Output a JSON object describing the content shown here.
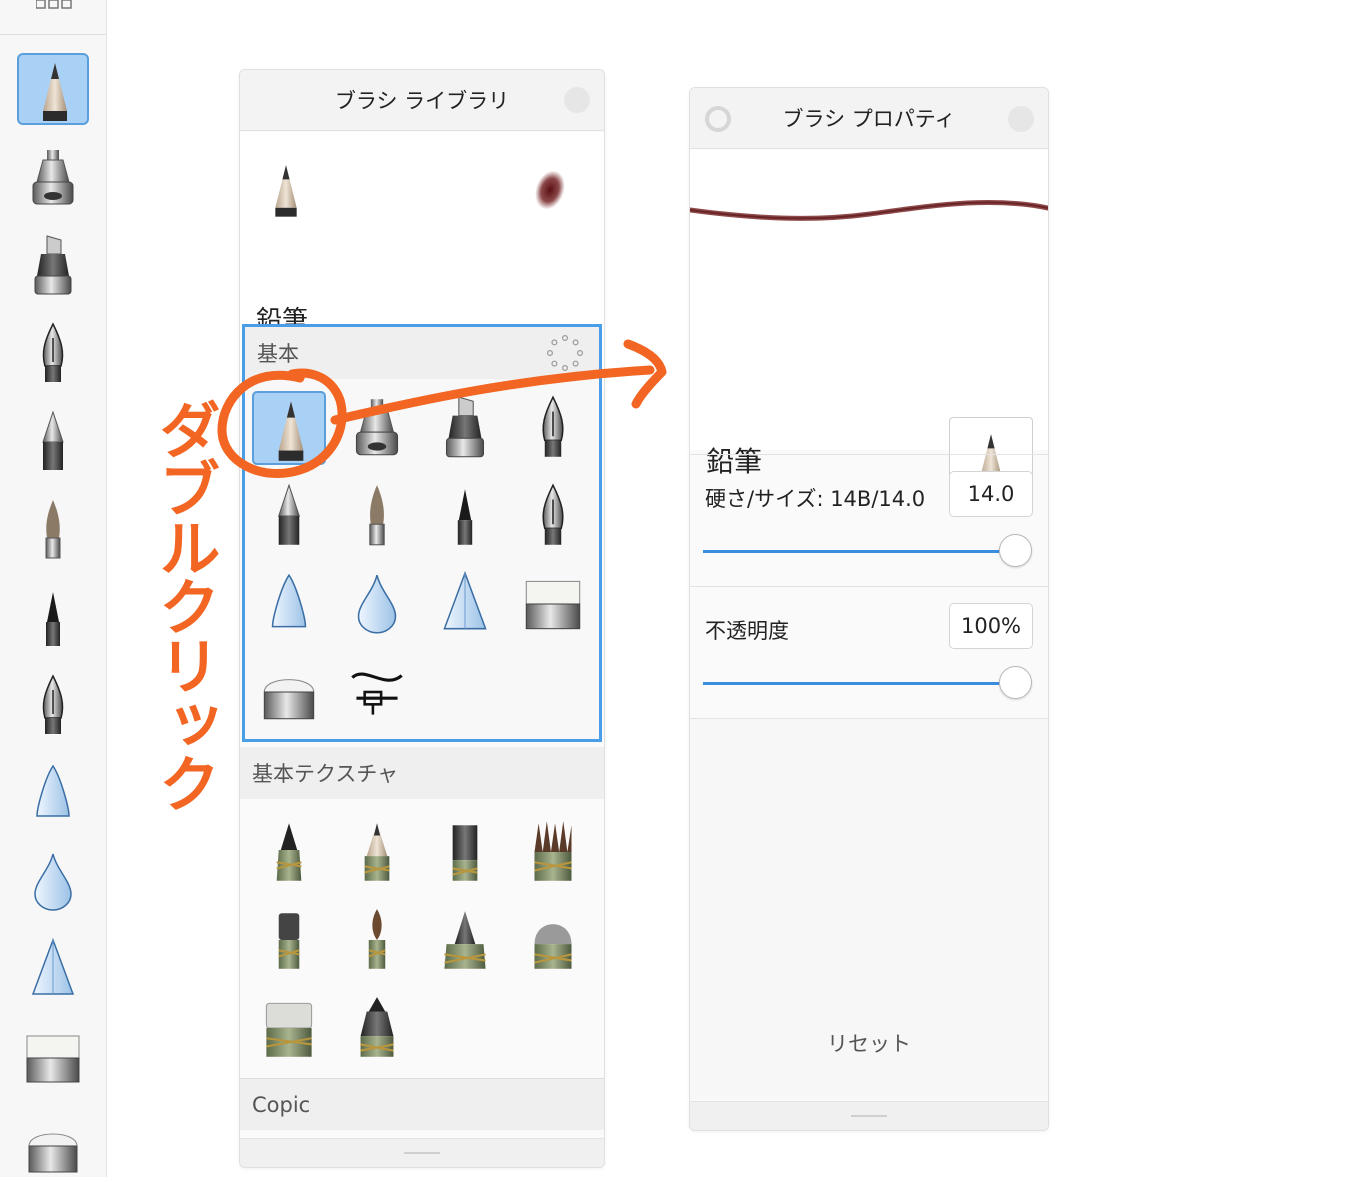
{
  "brush_library": {
    "title": "ブラシ ライブラリ",
    "selected_brush": {
      "name": "鉛筆",
      "set": "基本"
    },
    "sets": [
      {
        "name": "基本"
      },
      {
        "name": "基本テクスチャ"
      },
      {
        "name": "Copic"
      }
    ]
  },
  "brush_properties": {
    "title": "ブラシ プロパティ",
    "brush_name": "鉛筆",
    "hardness_size_label": "硬さ/サイズ: 14B/14.0",
    "hardness_size_value": "14.0",
    "hardness_size_level": 1.0,
    "opacity_label": "不透明度",
    "opacity_value": "100%",
    "opacity_level": 1.0,
    "reset_label": "リセット"
  },
  "annotation": {
    "text": "ダブルクリック",
    "color": "#f26522"
  },
  "colors": {
    "accent": "#4a9ee8",
    "selection_fill": "#a9d0f5",
    "stroke_preview": "#7a2a2a"
  }
}
